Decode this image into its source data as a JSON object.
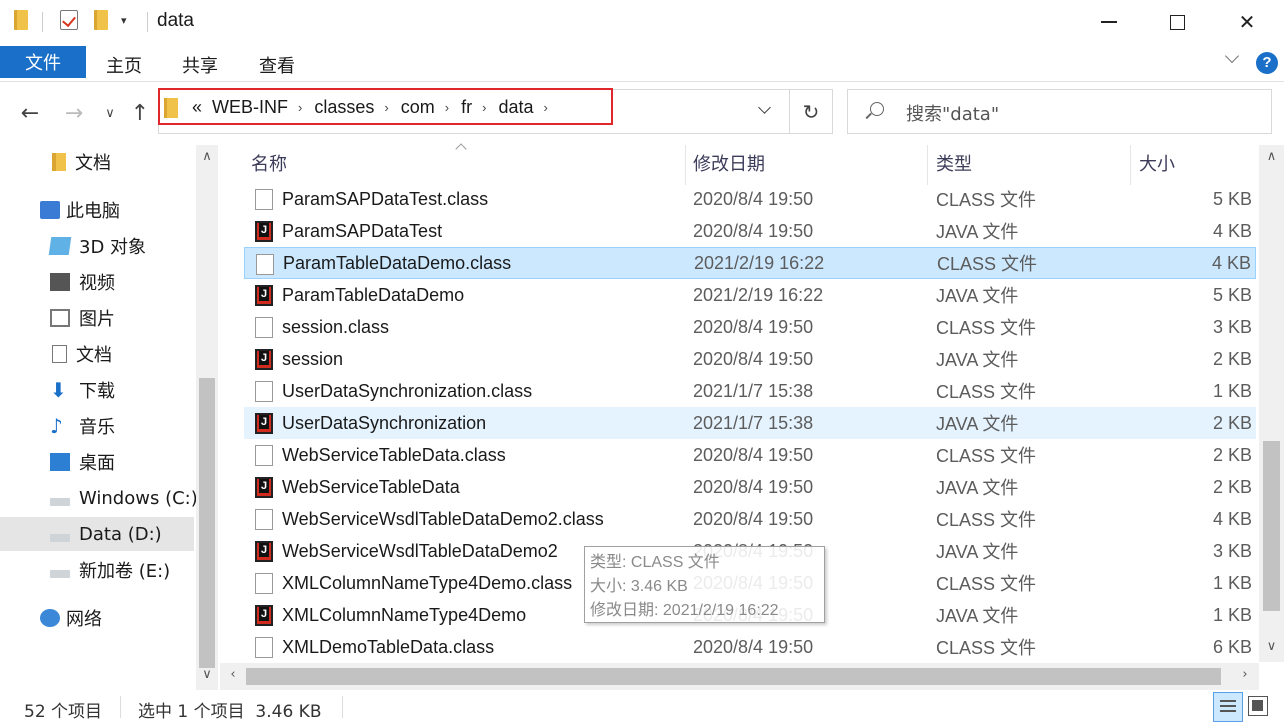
{
  "window": {
    "title": "data"
  },
  "ribbon": {
    "tabs": [
      "文件",
      "主页",
      "共享",
      "查看"
    ]
  },
  "address": {
    "overflow": "«",
    "crumbs": [
      "WEB-INF",
      "classes",
      "com",
      "fr",
      "data"
    ],
    "search_placeholder": "搜索\"data\""
  },
  "navpane": {
    "items": [
      {
        "label": "文档",
        "icon": "folder-icon"
      },
      {
        "label": "此电脑",
        "icon": "computer-icon"
      },
      {
        "label": "3D 对象",
        "icon": "3d-objects-icon"
      },
      {
        "label": "视频",
        "icon": "video-icon"
      },
      {
        "label": "图片",
        "icon": "pictures-icon"
      },
      {
        "label": "文档",
        "icon": "documents-icon"
      },
      {
        "label": "下载",
        "icon": "download-icon"
      },
      {
        "label": "音乐",
        "icon": "music-icon"
      },
      {
        "label": "桌面",
        "icon": "desktop-icon"
      },
      {
        "label": "Windows (C:)",
        "icon": "drive-icon"
      },
      {
        "label": "Data (D:)",
        "icon": "drive-icon"
      },
      {
        "label": "新加卷 (E:)",
        "icon": "drive-icon"
      },
      {
        "label": "网络",
        "icon": "network-icon"
      }
    ],
    "selected": "Data (D:)"
  },
  "columns": {
    "name": "名称",
    "date": "修改日期",
    "type": "类型",
    "size": "大小"
  },
  "files": [
    {
      "name": "ParamSAPDataTest.class",
      "date": "2020/8/4 19:50",
      "type": "CLASS 文件",
      "size": "5 KB",
      "kind": "class"
    },
    {
      "name": "ParamSAPDataTest",
      "date": "2020/8/4 19:50",
      "type": "JAVA 文件",
      "size": "4 KB",
      "kind": "java"
    },
    {
      "name": "ParamTableDataDemo.class",
      "date": "2021/2/19 16:22",
      "type": "CLASS 文件",
      "size": "4 KB",
      "kind": "class",
      "state": "selected"
    },
    {
      "name": "ParamTableDataDemo",
      "date": "2021/2/19 16:22",
      "type": "JAVA 文件",
      "size": "5 KB",
      "kind": "java"
    },
    {
      "name": "session.class",
      "date": "2020/8/4 19:50",
      "type": "CLASS 文件",
      "size": "3 KB",
      "kind": "class"
    },
    {
      "name": "session",
      "date": "2020/8/4 19:50",
      "type": "JAVA 文件",
      "size": "2 KB",
      "kind": "java"
    },
    {
      "name": "UserDataSynchronization.class",
      "date": "2021/1/7 15:38",
      "type": "CLASS 文件",
      "size": "1 KB",
      "kind": "class"
    },
    {
      "name": "UserDataSynchronization",
      "date": "2021/1/7 15:38",
      "type": "JAVA 文件",
      "size": "2 KB",
      "kind": "java",
      "state": "hover"
    },
    {
      "name": "WebServiceTableData.class",
      "date": "2020/8/4 19:50",
      "type": "CLASS 文件",
      "size": "2 KB",
      "kind": "class"
    },
    {
      "name": "WebServiceTableData",
      "date": "2020/8/4 19:50",
      "type": "JAVA 文件",
      "size": "2 KB",
      "kind": "java"
    },
    {
      "name": "WebServiceWsdlTableDataDemo2.class",
      "date": "2020/8/4 19:50",
      "type": "CLASS 文件",
      "size": "4 KB",
      "kind": "class"
    },
    {
      "name": "WebServiceWsdlTableDataDemo2",
      "date": "2020/8/4 19:50",
      "type": "JAVA 文件",
      "size": "3 KB",
      "kind": "java"
    },
    {
      "name": "XMLColumnNameType4Demo.class",
      "date": "2020/8/4 19:50",
      "type": "CLASS 文件",
      "size": "1 KB",
      "kind": "class"
    },
    {
      "name": "XMLColumnNameType4Demo",
      "date": "2020/8/4 19:50",
      "type": "JAVA 文件",
      "size": "1 KB",
      "kind": "java"
    },
    {
      "name": "XMLDemoTableData.class",
      "date": "2020/8/4 19:50",
      "type": "CLASS 文件",
      "size": "6 KB",
      "kind": "class"
    }
  ],
  "tooltip": {
    "lines": [
      "类型: CLASS 文件",
      "大小: 3.46 KB",
      "修改日期: 2021/2/19 16:22"
    ]
  },
  "status": {
    "count": "52 个项目",
    "selection": "选中 1 个项目  3.46 KB"
  },
  "colors": {
    "accent": "#1a6fc9",
    "selection": "#cce8ff",
    "highlight_box": "#e0282c",
    "java_icon": "#d02b1e"
  }
}
